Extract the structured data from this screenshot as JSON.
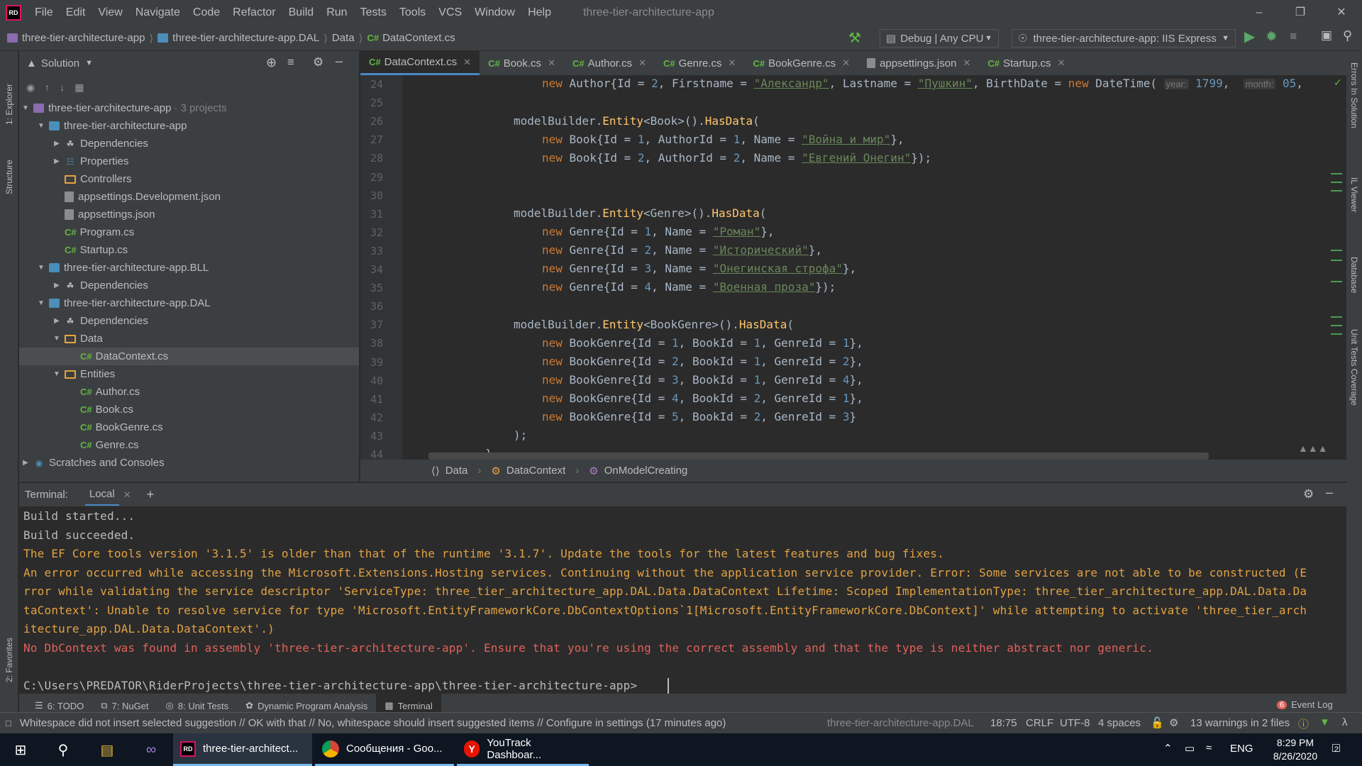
{
  "menu": {
    "logo": "RD",
    "items": [
      "File",
      "Edit",
      "View",
      "Navigate",
      "Code",
      "Refactor",
      "Build",
      "Run",
      "Tests",
      "Tools",
      "VCS",
      "Window",
      "Help"
    ],
    "window_title": "three-tier-architecture-app"
  },
  "navbar": {
    "crumbs": [
      "three-tier-architecture-app",
      "three-tier-architecture-app.DAL",
      "Data",
      "DataContext.cs"
    ],
    "config": "Debug | Any CPU",
    "run_target": "three-tier-architecture-app: IIS Express"
  },
  "solution": {
    "title": "Solution",
    "root": {
      "label": "three-tier-architecture-app",
      "meta": "3 projects"
    },
    "rows": [
      {
        "label": "three-tier-architecture-app",
        "kind": "proj"
      },
      {
        "label": "Dependencies",
        "kind": "dep"
      },
      {
        "label": "Properties",
        "kind": "prop"
      },
      {
        "label": "Controllers",
        "kind": "folder"
      },
      {
        "label": "appsettings.Development.json",
        "kind": "json"
      },
      {
        "label": "appsettings.json",
        "kind": "json"
      },
      {
        "label": "Program.cs",
        "kind": "cs"
      },
      {
        "label": "Startup.cs",
        "kind": "cs"
      },
      {
        "label": "three-tier-architecture-app.BLL",
        "kind": "proj"
      },
      {
        "label": "Dependencies",
        "kind": "dep"
      },
      {
        "label": "three-tier-architecture-app.DAL",
        "kind": "proj"
      },
      {
        "label": "Dependencies",
        "kind": "dep"
      },
      {
        "label": "Data",
        "kind": "folder"
      },
      {
        "label": "DataContext.cs",
        "kind": "cs"
      },
      {
        "label": "Entities",
        "kind": "folder"
      },
      {
        "label": "Author.cs",
        "kind": "cs"
      },
      {
        "label": "Book.cs",
        "kind": "cs"
      },
      {
        "label": "BookGenre.cs",
        "kind": "cs"
      },
      {
        "label": "Genre.cs",
        "kind": "cs"
      },
      {
        "label": "Scratches and Consoles",
        "kind": "scratch"
      }
    ]
  },
  "tabs": [
    "DataContext.cs",
    "Book.cs",
    "Author.cs",
    "Genre.cs",
    "BookGenre.cs",
    "appsettings.json",
    "Startup.cs"
  ],
  "tab_prefix": "C#",
  "editor": {
    "line_numbers": [
      "24",
      "25",
      "26",
      "27",
      "28",
      "29",
      "30",
      "31",
      "32",
      "33",
      "34",
      "35",
      "36",
      "37",
      "38",
      "39",
      "40",
      "41",
      "42",
      "43",
      "44"
    ],
    "hint_year": "year:",
    "hint_month": "month:",
    "strings": {
      "alexander": "\"Александр\"",
      "pushkin": "\"Пушкин\"",
      "war": "\"Война и мир\"",
      "onegin": "\"Евгений Онегин\"",
      "roman": "\"Роман\"",
      "hist": "\"Исторический\"",
      "stanza": "\"Онегинская строфа\"",
      "prose": "\"Военная проза\""
    }
  },
  "code_breadcrumb": [
    "Data",
    "DataContext",
    "OnModelCreating"
  ],
  "terminal": {
    "label": "Terminal:",
    "tab": "Local",
    "lines": [
      {
        "text": "Build started...",
        "kind": "normal"
      },
      {
        "text": "Build succeeded.",
        "kind": "normal"
      },
      {
        "text": "The EF Core tools version '3.1.5' is older than that of the runtime '3.1.7'. Update the tools for the latest features and bug fixes.",
        "kind": "warn"
      },
      {
        "text": "An error occurred while accessing the Microsoft.Extensions.Hosting services. Continuing without the application service provider. Error: Some services are not able to be constructed (E",
        "kind": "warn"
      },
      {
        "text": "rror while validating the service descriptor 'ServiceType: three_tier_architecture_app.DAL.Data.DataContext Lifetime: Scoped ImplementationType: three_tier_architecture_app.DAL.Data.Da",
        "kind": "warn"
      },
      {
        "text": "taContext': Unable to resolve service for type 'Microsoft.EntityFrameworkCore.DbContextOptions`1[Microsoft.EntityFrameworkCore.DbContext]' while attempting to activate 'three_tier_arch",
        "kind": "warn"
      },
      {
        "text": "itecture_app.DAL.Data.DataContext'.)",
        "kind": "warn"
      },
      {
        "text": "No DbContext was found in assembly 'three-tier-architecture-app'. Ensure that you're using the correct assembly and that the type is neither abstract nor generic.",
        "kind": "err"
      },
      {
        "text": "",
        "kind": "normal"
      },
      {
        "text": "C:\\Users\\PREDATOR\\RiderProjects\\three-tier-architecture-app\\three-tier-architecture-app>",
        "kind": "normal"
      }
    ]
  },
  "tool_tabs": [
    "6: TODO",
    "7: NuGet",
    "8: Unit Tests",
    "Dynamic Program Analysis",
    "Terminal"
  ],
  "event_log": {
    "count": "6",
    "label": "Event Log"
  },
  "status": {
    "message": "Whitespace did not insert selected suggestion // OK with that // No, whitespace should insert suggested items // Configure in settings (17 minutes ago)",
    "project": "three-tier-architecture-app.DAL",
    "position": "18:75",
    "line_ending": "CRLF",
    "encoding": "UTF-8",
    "indent": "4 spaces",
    "warnings": "13 warnings in 2 files"
  },
  "side": {
    "left": [
      "1: Explorer",
      "Structure",
      "2: Favorites"
    ],
    "right": [
      "Errors In Solution",
      "IL Viewer",
      "Database",
      "Unit Tests Coverage"
    ]
  },
  "taskbar": {
    "apps": [
      {
        "label": "three-tier-architect...",
        "active": true
      },
      {
        "label": "Сообщения - Goo...",
        "active": false
      },
      {
        "label": "YouTrack Dashboar...",
        "active": false
      }
    ],
    "lang": "ENG",
    "time": "8:29 PM",
    "date": "8/26/2020",
    "notif": "2"
  }
}
